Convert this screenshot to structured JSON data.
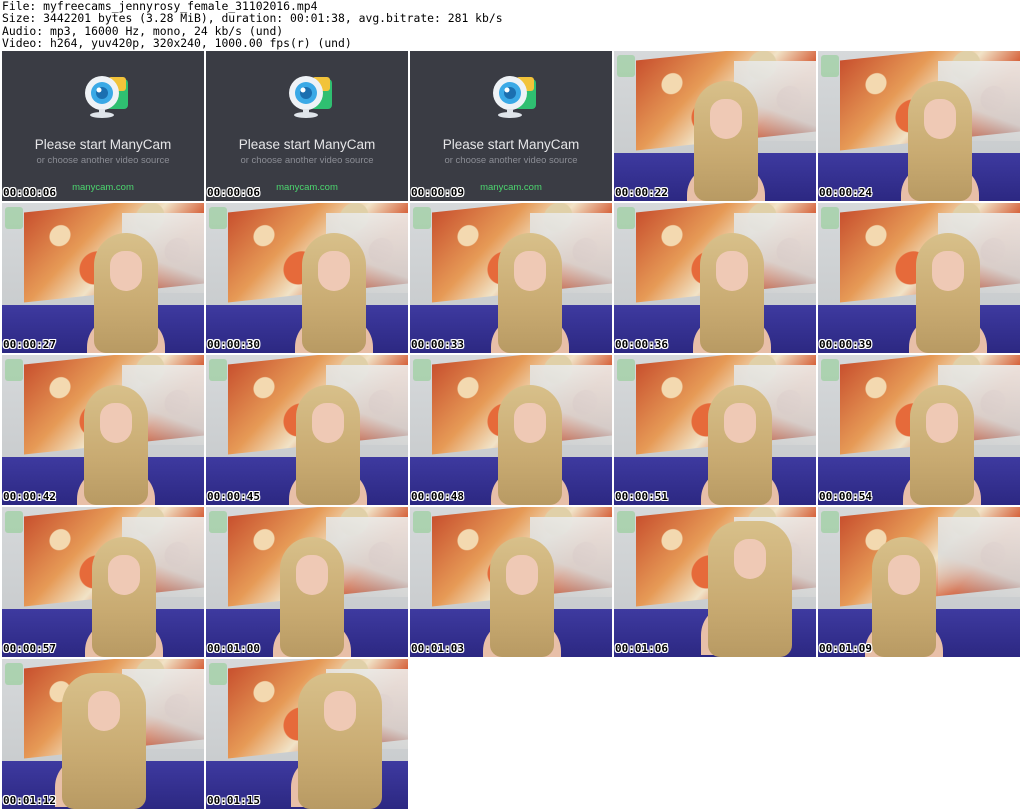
{
  "header": {
    "line1": "File: myfreecams_jennyrosy_female_31102016.mp4",
    "line2": "Size: 3442201 bytes (3.28 MiB), duration: 00:01:38, avg.bitrate: 281 kb/s",
    "line3": "Audio: mp3, 16000 Hz, mono, 24 kb/s (und)",
    "line4": "Video: h264, yuv420p, 320x240, 1000.00 fps(r) (und)"
  },
  "placeholder": {
    "title": "Please start ManyCam",
    "subtitle": "or choose another video source",
    "link": "manycam.com",
    "icon": "webcam-icon",
    "link_color": "#4cd66f"
  },
  "thumbnails": [
    {
      "time": "00:00:06",
      "kind": "placeholder"
    },
    {
      "time": "00:00:06",
      "kind": "placeholder"
    },
    {
      "time": "00:00:09",
      "kind": "placeholder"
    },
    {
      "time": "00:00:22",
      "kind": "video"
    },
    {
      "time": "00:00:24",
      "kind": "video"
    },
    {
      "time": "00:00:27",
      "kind": "video"
    },
    {
      "time": "00:00:30",
      "kind": "video"
    },
    {
      "time": "00:00:33",
      "kind": "video"
    },
    {
      "time": "00:00:36",
      "kind": "video"
    },
    {
      "time": "00:00:39",
      "kind": "video"
    },
    {
      "time": "00:00:42",
      "kind": "video"
    },
    {
      "time": "00:00:45",
      "kind": "video"
    },
    {
      "time": "00:00:48",
      "kind": "video"
    },
    {
      "time": "00:00:51",
      "kind": "video"
    },
    {
      "time": "00:00:54",
      "kind": "video"
    },
    {
      "time": "00:00:57",
      "kind": "video"
    },
    {
      "time": "00:01:00",
      "kind": "video"
    },
    {
      "time": "00:01:03",
      "kind": "video"
    },
    {
      "time": "00:01:06",
      "kind": "video"
    },
    {
      "time": "00:01:09",
      "kind": "video"
    },
    {
      "time": "00:01:12",
      "kind": "video"
    },
    {
      "time": "00:01:15",
      "kind": "video"
    }
  ]
}
